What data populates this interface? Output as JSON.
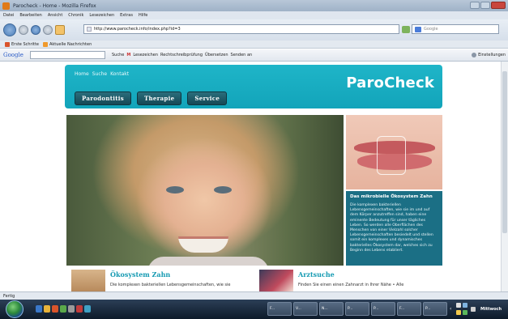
{
  "window": {
    "title": "Parocheck - Home - Mozilla Firefox"
  },
  "menu": {
    "items": [
      "Datei",
      "Bearbeiten",
      "Ansicht",
      "Chronik",
      "Lesezeichen",
      "Extras",
      "Hilfe"
    ]
  },
  "navigation": {
    "url": "http://www.parocheck.info/index.php?id=3",
    "search_placeholder": "Google"
  },
  "bookmarks": {
    "items": [
      "Erste Schritte",
      "Aktuelle Nachrichten"
    ]
  },
  "google_toolbar": {
    "logo": "Google",
    "items": [
      "Suche",
      "M",
      "Lesezeichen",
      "Rechtschreibprüfung",
      "Übersetzen",
      "Senden an"
    ],
    "settings": "Einstellungen"
  },
  "site": {
    "top_links": [
      "Home",
      "Suche",
      "Kontakt"
    ],
    "logo": "ParoCheck",
    "tabs": [
      "Parodontitis",
      "Therapie",
      "Service"
    ],
    "info_box": {
      "title": "Das mikrobielle Ökosystem Zahn",
      "text": "Die komplexen bakteriellen Lebensgemeinschaften, wie sie im und auf dem Körper anzutreffen sind, haben eine eminente Bedeutung für unser tägliches Leben. So werden alle Oberflächen des Menschen von einer Vielzahl solcher Lebensgemeinschaften besiedelt und stellen somit ein komplexes und dynamisches bakterielles Ökosystem dar, welches sich zu Beginn des Lebens etabliert."
    },
    "teasers": [
      {
        "title": "Ökosystem Zahn",
        "text": "Die komplexen bakteriellen Lebensgemeinschaften, wie sie"
      },
      {
        "title": "Arztsuche",
        "text": "Finden Sie einen einen Zahnarzt in Ihrer Nähe • Alle"
      }
    ]
  },
  "status": {
    "text": "Fertig"
  },
  "taskbar": {
    "tasks": [
      "F...",
      "V...",
      "N...",
      "P...",
      "P...",
      "F...",
      "P...",
      "P..."
    ],
    "clock": "Mittwoch"
  }
}
